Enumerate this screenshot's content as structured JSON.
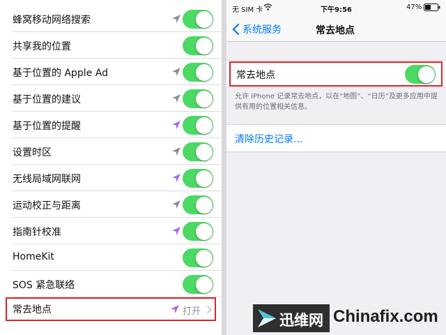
{
  "left_panel": {
    "rows": [
      {
        "label": "蜂窝移动网络搜索",
        "location_arrow": "gray",
        "toggle_on": true
      },
      {
        "label": "共享我的位置",
        "location_arrow": "none",
        "toggle_on": true
      },
      {
        "label": "基于位置的 Apple Ad",
        "location_arrow": "gray",
        "toggle_on": true
      },
      {
        "label": "基于位置的建议",
        "location_arrow": "gray",
        "toggle_on": true
      },
      {
        "label": "基于位置的提醒",
        "location_arrow": "purple",
        "toggle_on": true
      },
      {
        "label": "设置时区",
        "location_arrow": "gray",
        "toggle_on": true
      },
      {
        "label": "无线局域网联网",
        "location_arrow": "purple",
        "toggle_on": true
      },
      {
        "label": "运动校正与距离",
        "location_arrow": "gray",
        "toggle_on": true
      },
      {
        "label": "指南针校准",
        "location_arrow": "purple",
        "toggle_on": true
      },
      {
        "label": "HomeKit",
        "location_arrow": "none",
        "toggle_on": true
      },
      {
        "label": "SOS 紧急联络",
        "location_arrow": "none",
        "toggle_on": true
      }
    ],
    "frequent_row": {
      "label": "常去地点",
      "value": "打开",
      "location_arrow": "purple"
    }
  },
  "right_panel": {
    "status": {
      "carrier": "无 SIM 卡",
      "time": "下午9:56",
      "battery": "47%",
      "battery_level": 0.47
    },
    "nav": {
      "back_label": "系统服务",
      "title": "常去地点"
    },
    "frequent": {
      "label": "常去地点",
      "toggle_on": true
    },
    "footnote": "允许 iPhone 记录常去地点，以在“地图”、“日历”及更多应用中提供有用的位置相关信息。",
    "clear_history": "清除历史记录..."
  },
  "watermark": {
    "cn": "迅维网",
    "en": "Chinafix.com"
  },
  "colors": {
    "toggle_on": "#4cd964",
    "accent_blue": "#007aff",
    "highlight_red": "#d6242a",
    "arrow_gray": "#8e8e93",
    "arrow_purple": "#a56bf0"
  }
}
